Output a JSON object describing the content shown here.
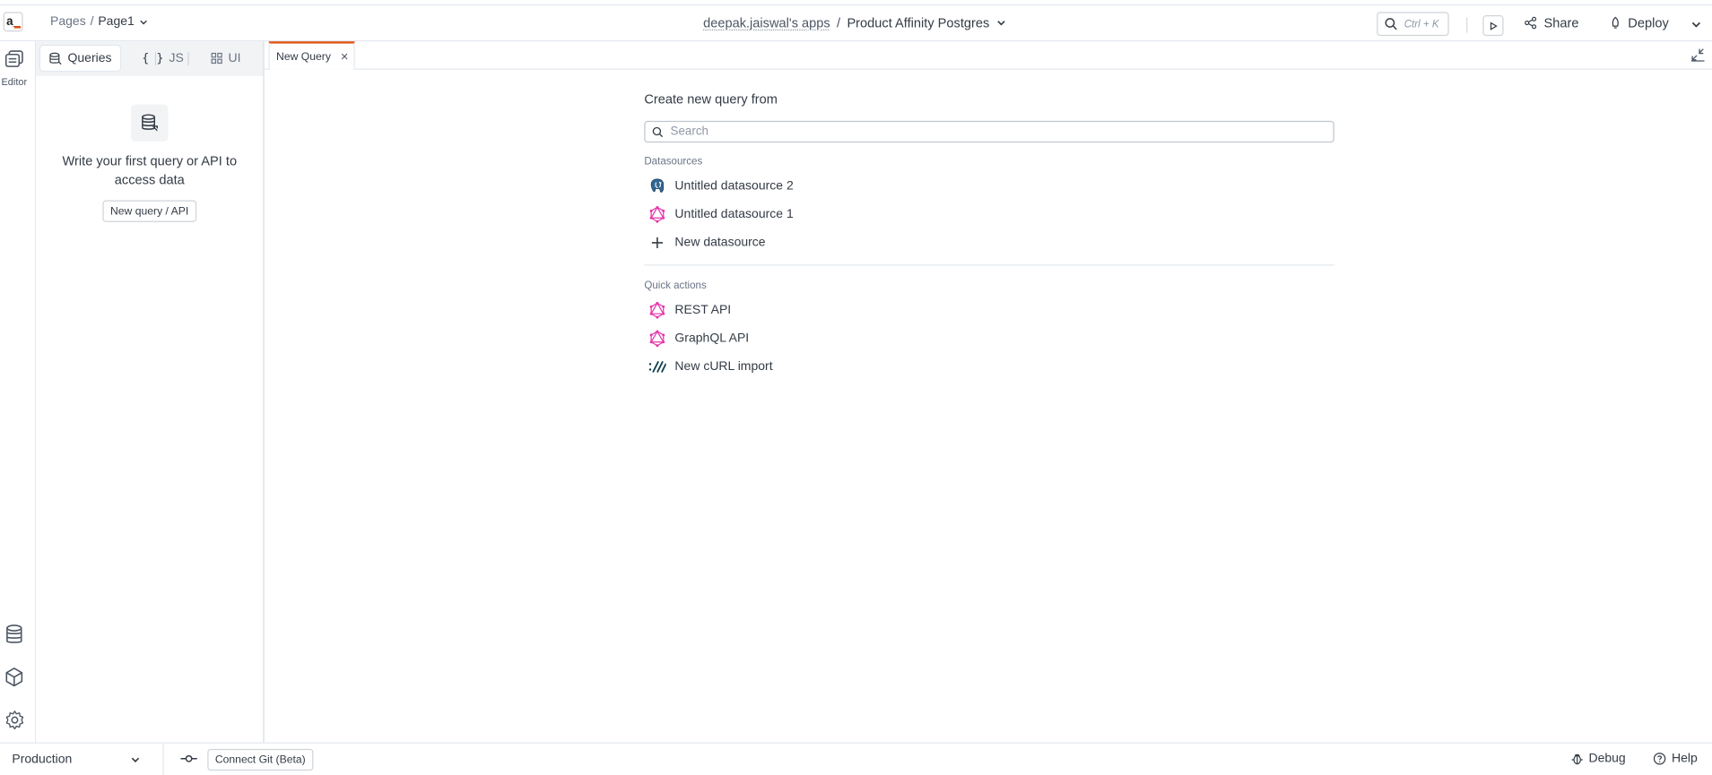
{
  "header": {
    "logo_text": "a_",
    "breadcrumb_root": "Pages",
    "breadcrumb_sep": "/",
    "breadcrumb_page": "Page1",
    "workspace": "deepak.jaiswal's apps",
    "app_sep": "/",
    "app_name": "Product Affinity Postgres",
    "search_shortcut": "Ctrl + K",
    "share_label": "Share",
    "deploy_label": "Deploy"
  },
  "rail": {
    "editor_label": "Editor",
    "icons": [
      "pages-icon",
      "datasource-icon",
      "package-icon",
      "settings-icon"
    ]
  },
  "explorer": {
    "segments": [
      "Queries",
      "JS",
      "UI"
    ],
    "active_segment": "Queries",
    "empty_text": "Write your first query or API to access data",
    "empty_button": "New query / API"
  },
  "tabs": [
    {
      "label": "New Query",
      "active": true
    }
  ],
  "main": {
    "title": "Create new query from",
    "search_placeholder": "Search",
    "datasources_label": "Datasources",
    "datasources": [
      {
        "label": "Untitled datasource 2",
        "icon": "postgres-icon"
      },
      {
        "label": "Untitled datasource 1",
        "icon": "graphql-icon"
      },
      {
        "label": "New datasource",
        "icon": "plus-icon"
      }
    ],
    "quick_actions_label": "Quick actions",
    "quick_actions": [
      {
        "label": "REST API",
        "icon": "graphql-icon"
      },
      {
        "label": "GraphQL API",
        "icon": "graphql-icon"
      },
      {
        "label": "New cURL import",
        "icon": "curl-icon"
      }
    ]
  },
  "footer": {
    "environment": "Production",
    "git_label": "Connect Git (Beta)",
    "debug_label": "Debug",
    "help_label": "Help"
  },
  "colors": {
    "accent": "#e15615",
    "graphql_pink": "#e535ab",
    "text": "#333b45"
  }
}
